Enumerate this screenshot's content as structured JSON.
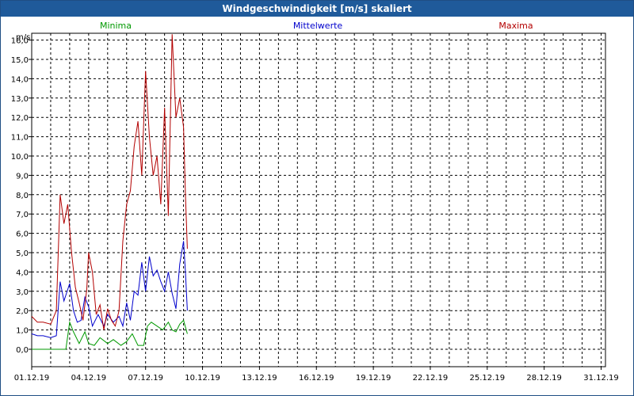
{
  "window": {
    "title": "Windgeschwindigkeit [m/s] skaliert"
  },
  "colors": {
    "minima": "#009900",
    "mittelwerte": "#0000cc",
    "maxima": "#b30000",
    "titlebar": "#1f5a9a"
  },
  "chart_data": {
    "type": "line",
    "title": "Windgeschwindigkeit [m/s] skaliert",
    "ylabel": "m/s",
    "xlabel": "",
    "ylim": [
      0,
      16.5
    ],
    "yticks": [
      "0,0",
      "1,0",
      "2,0",
      "3,0",
      "4,0",
      "5,0",
      "6,0",
      "7,0",
      "8,0",
      "9,0",
      "10,0",
      "11,0",
      "12,0",
      "13,0",
      "14,0",
      "15,0",
      "16,0"
    ],
    "xticks": [
      "01.12.19",
      "04.12.19",
      "07.12.19",
      "10.12.19",
      "13.12.19",
      "16.12.19",
      "19.12.19",
      "22.12.19",
      "25.12.19",
      "28.12.19",
      "31.12.19"
    ],
    "grid": true,
    "x_unit": "days",
    "series": [
      {
        "name": "Minima",
        "x": [
          1.0,
          1.5,
          2.0,
          2.5,
          2.8,
          3.0,
          3.2,
          3.5,
          3.8,
          4.0,
          4.3,
          4.6,
          5.0,
          5.3,
          5.7,
          6.0,
          6.3,
          6.6,
          6.9,
          7.1,
          7.3,
          7.6,
          7.9,
          8.2,
          8.4,
          8.6,
          8.8,
          9.0,
          9.2
        ],
        "values": [
          0.0,
          0.0,
          0.0,
          0.0,
          0.0,
          1.4,
          0.9,
          0.3,
          0.9,
          0.3,
          0.2,
          0.6,
          0.3,
          0.5,
          0.2,
          0.4,
          0.8,
          0.2,
          0.2,
          1.2,
          1.4,
          1.2,
          1.0,
          1.4,
          1.0,
          0.9,
          1.3,
          1.5,
          0.8
        ]
      },
      {
        "name": "Mittelwerte",
        "x": [
          1.0,
          1.3,
          1.6,
          2.0,
          2.3,
          2.5,
          2.7,
          3.0,
          3.2,
          3.4,
          3.6,
          3.8,
          4.0,
          4.2,
          4.5,
          4.8,
          5.0,
          5.3,
          5.6,
          5.8,
          6.0,
          6.2,
          6.4,
          6.6,
          6.8,
          7.0,
          7.2,
          7.4,
          7.6,
          7.8,
          8.0,
          8.2,
          8.4,
          8.6,
          8.8,
          9.0,
          9.1,
          9.2
        ],
        "values": [
          0.8,
          0.7,
          0.7,
          0.6,
          0.7,
          3.5,
          2.5,
          3.4,
          2.0,
          1.4,
          1.5,
          2.7,
          2.2,
          1.2,
          1.8,
          1.2,
          1.8,
          1.4,
          1.7,
          1.2,
          2.4,
          1.5,
          3.0,
          2.8,
          4.5,
          3.0,
          4.8,
          3.8,
          4.1,
          3.5,
          3.0,
          4.0,
          2.9,
          2.1,
          4.4,
          5.6,
          4.0,
          2.0
        ]
      },
      {
        "name": "Maxima",
        "x": [
          1.0,
          1.3,
          1.6,
          2.0,
          2.3,
          2.5,
          2.7,
          2.9,
          3.1,
          3.3,
          3.5,
          3.7,
          3.9,
          4.0,
          4.2,
          4.4,
          4.6,
          4.8,
          5.0,
          5.2,
          5.4,
          5.6,
          5.8,
          6.0,
          6.2,
          6.4,
          6.6,
          6.8,
          7.0,
          7.2,
          7.4,
          7.6,
          7.8,
          8.0,
          8.2,
          8.4,
          8.6,
          8.8,
          9.0,
          9.1,
          9.2
        ],
        "values": [
          1.7,
          1.4,
          1.4,
          1.3,
          2.0,
          8.0,
          6.5,
          7.5,
          5.0,
          3.2,
          2.4,
          1.5,
          3.1,
          5.0,
          4.0,
          1.8,
          2.3,
          1.0,
          2.1,
          1.5,
          1.2,
          2.0,
          5.6,
          7.5,
          8.2,
          10.5,
          11.8,
          9.0,
          14.4,
          11.0,
          9.0,
          10.0,
          7.5,
          12.5,
          6.9,
          16.3,
          12.0,
          13.0,
          11.5,
          8.0,
          5.2
        ]
      }
    ]
  }
}
